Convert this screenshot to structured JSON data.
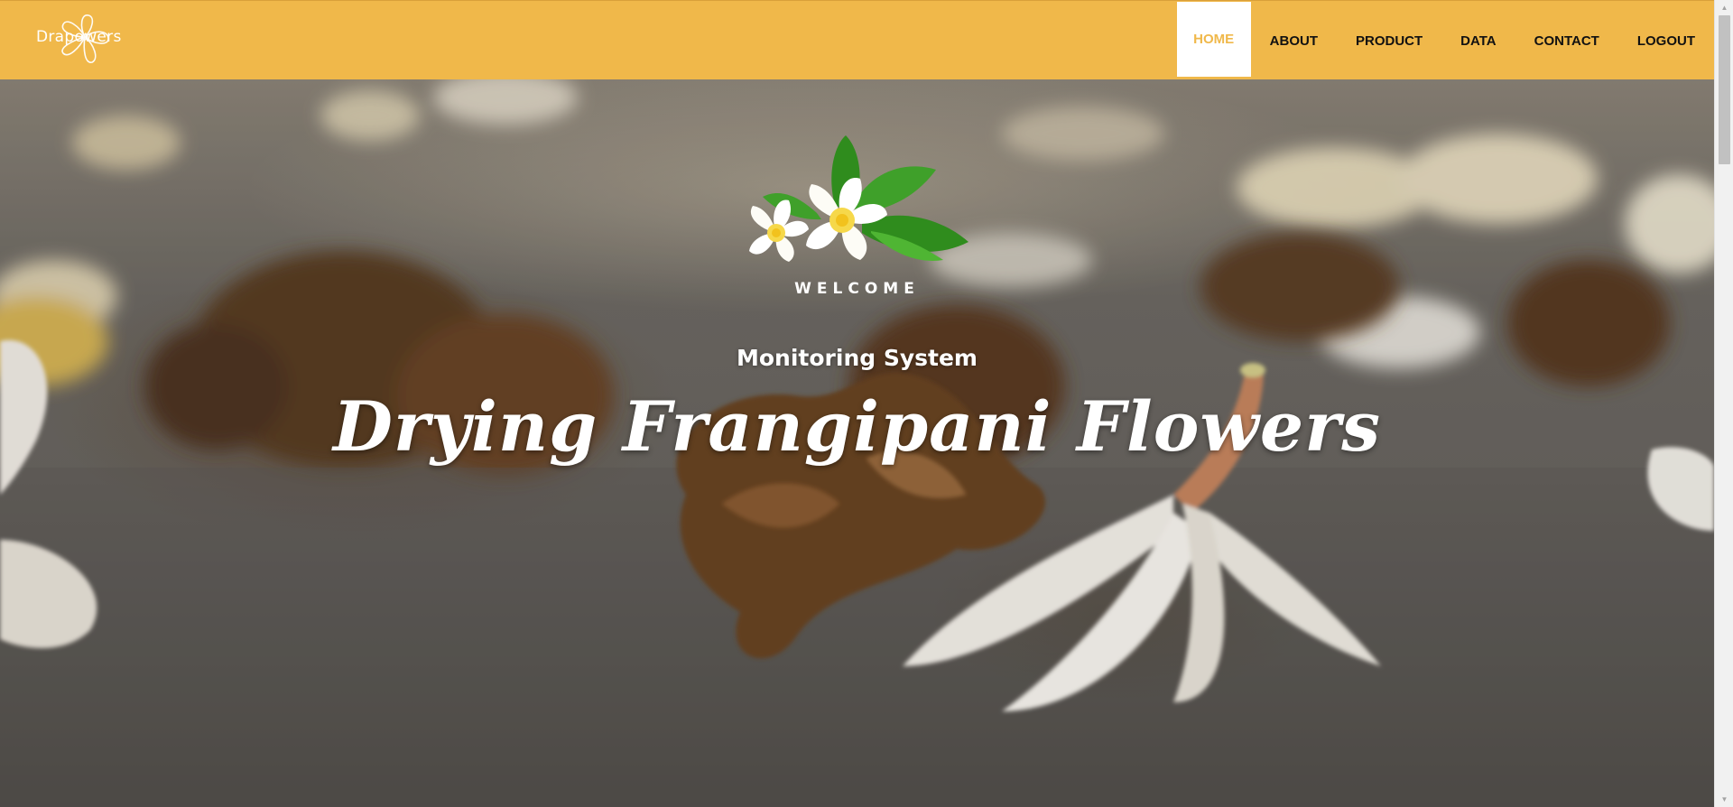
{
  "header": {
    "brand_text": "Drapowers",
    "logo_icon": "frangipani-outline-icon",
    "nav": [
      {
        "label": "HOME",
        "active": true
      },
      {
        "label": "ABOUT",
        "active": false
      },
      {
        "label": "PRODUCT",
        "active": false
      },
      {
        "label": "DATA",
        "active": false
      },
      {
        "label": "CONTACT",
        "active": false
      },
      {
        "label": "LOGOUT",
        "active": false
      }
    ]
  },
  "hero": {
    "logo_icon": "frangipani-flowers-icon",
    "welcome": "WELCOME",
    "subtitle": "Monitoring System",
    "title": "Drying Frangipani Flowers"
  },
  "colors": {
    "header_bg": "#f0b84a",
    "active_nav_bg": "#ffffff",
    "active_nav_text": "#f0b84a",
    "nav_text": "#111111",
    "hero_text": "#ffffff"
  }
}
